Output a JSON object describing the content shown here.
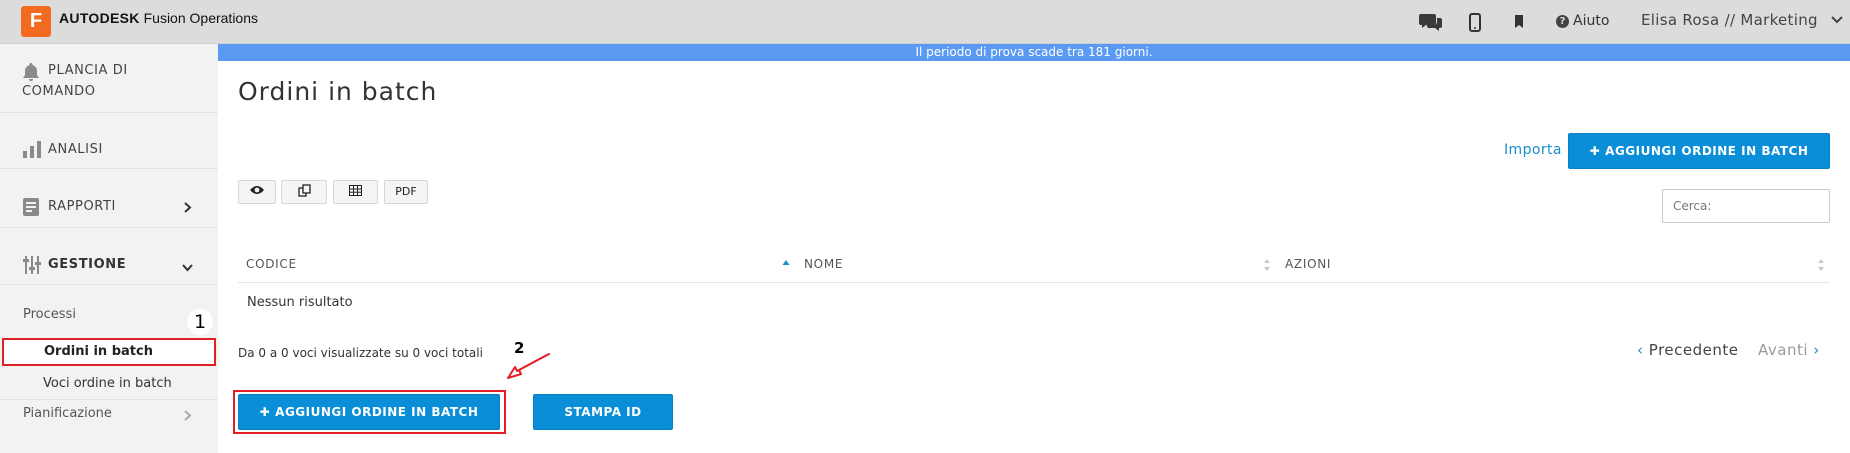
{
  "header": {
    "logo_letter": "F",
    "brand_bold": "AUTODESK",
    "brand_rest": "Fusion Operations",
    "help_label": "Aiuto",
    "user_label": "Elisa Rosa // Marketing"
  },
  "trial_banner": "Il periodo di prova scade tra 181 giorni.",
  "sidebar": {
    "dashboard_line1": "PLANCIA DI",
    "dashboard_line2": "COMANDO",
    "analysis": "ANALISI",
    "reports": "RAPPORTI",
    "management": "GESTIONE",
    "processes": "Processi",
    "batch_orders": "Ordini in batch",
    "batch_order_items": "Voci ordine in batch",
    "planning": "Pianificazione"
  },
  "annotations": {
    "step1": "1",
    "step2": "2"
  },
  "main": {
    "title": "Ordini in batch",
    "import_link": "Importa",
    "add_button_top": "AGGIUNGI ORDINE IN BATCH",
    "add_button_bottom": "AGGIUNGI ORDINE IN BATCH",
    "print_id_button": "STAMPA ID",
    "tools": {
      "pdf": "PDF"
    },
    "search_placeholder": "Cerca:",
    "columns": [
      "CODICE",
      "NOME",
      "AZIONI"
    ],
    "empty_message": "Nessun risultato",
    "info_text": "Da 0 a 0 voci visualizzate su 0 voci totali",
    "pager": {
      "prev": "Precedente",
      "next": "Avanti"
    }
  },
  "colors": {
    "accent": "#0b8ed8",
    "banner": "#5b9af2",
    "annotation": "#e31f26",
    "brand": "#f26b21"
  }
}
